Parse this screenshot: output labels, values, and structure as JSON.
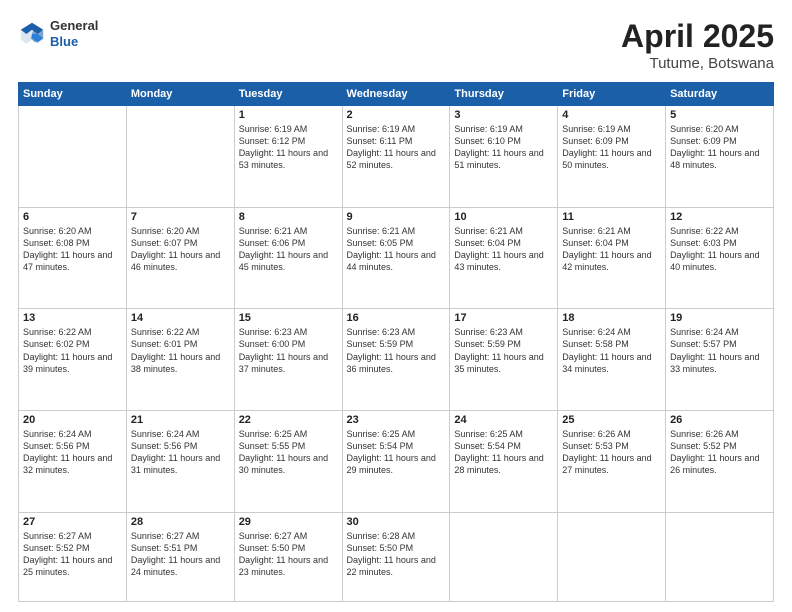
{
  "header": {
    "logo": {
      "general": "General",
      "blue": "Blue"
    },
    "title": "April 2025",
    "location": "Tutume, Botswana"
  },
  "weekdays": [
    "Sunday",
    "Monday",
    "Tuesday",
    "Wednesday",
    "Thursday",
    "Friday",
    "Saturday"
  ],
  "weeks": [
    [
      {
        "day": "",
        "info": ""
      },
      {
        "day": "",
        "info": ""
      },
      {
        "day": "1",
        "info": "Sunrise: 6:19 AM\nSunset: 6:12 PM\nDaylight: 11 hours and 53 minutes."
      },
      {
        "day": "2",
        "info": "Sunrise: 6:19 AM\nSunset: 6:11 PM\nDaylight: 11 hours and 52 minutes."
      },
      {
        "day": "3",
        "info": "Sunrise: 6:19 AM\nSunset: 6:10 PM\nDaylight: 11 hours and 51 minutes."
      },
      {
        "day": "4",
        "info": "Sunrise: 6:19 AM\nSunset: 6:09 PM\nDaylight: 11 hours and 50 minutes."
      },
      {
        "day": "5",
        "info": "Sunrise: 6:20 AM\nSunset: 6:09 PM\nDaylight: 11 hours and 48 minutes."
      }
    ],
    [
      {
        "day": "6",
        "info": "Sunrise: 6:20 AM\nSunset: 6:08 PM\nDaylight: 11 hours and 47 minutes."
      },
      {
        "day": "7",
        "info": "Sunrise: 6:20 AM\nSunset: 6:07 PM\nDaylight: 11 hours and 46 minutes."
      },
      {
        "day": "8",
        "info": "Sunrise: 6:21 AM\nSunset: 6:06 PM\nDaylight: 11 hours and 45 minutes."
      },
      {
        "day": "9",
        "info": "Sunrise: 6:21 AM\nSunset: 6:05 PM\nDaylight: 11 hours and 44 minutes."
      },
      {
        "day": "10",
        "info": "Sunrise: 6:21 AM\nSunset: 6:04 PM\nDaylight: 11 hours and 43 minutes."
      },
      {
        "day": "11",
        "info": "Sunrise: 6:21 AM\nSunset: 6:04 PM\nDaylight: 11 hours and 42 minutes."
      },
      {
        "day": "12",
        "info": "Sunrise: 6:22 AM\nSunset: 6:03 PM\nDaylight: 11 hours and 40 minutes."
      }
    ],
    [
      {
        "day": "13",
        "info": "Sunrise: 6:22 AM\nSunset: 6:02 PM\nDaylight: 11 hours and 39 minutes."
      },
      {
        "day": "14",
        "info": "Sunrise: 6:22 AM\nSunset: 6:01 PM\nDaylight: 11 hours and 38 minutes."
      },
      {
        "day": "15",
        "info": "Sunrise: 6:23 AM\nSunset: 6:00 PM\nDaylight: 11 hours and 37 minutes."
      },
      {
        "day": "16",
        "info": "Sunrise: 6:23 AM\nSunset: 5:59 PM\nDaylight: 11 hours and 36 minutes."
      },
      {
        "day": "17",
        "info": "Sunrise: 6:23 AM\nSunset: 5:59 PM\nDaylight: 11 hours and 35 minutes."
      },
      {
        "day": "18",
        "info": "Sunrise: 6:24 AM\nSunset: 5:58 PM\nDaylight: 11 hours and 34 minutes."
      },
      {
        "day": "19",
        "info": "Sunrise: 6:24 AM\nSunset: 5:57 PM\nDaylight: 11 hours and 33 minutes."
      }
    ],
    [
      {
        "day": "20",
        "info": "Sunrise: 6:24 AM\nSunset: 5:56 PM\nDaylight: 11 hours and 32 minutes."
      },
      {
        "day": "21",
        "info": "Sunrise: 6:24 AM\nSunset: 5:56 PM\nDaylight: 11 hours and 31 minutes."
      },
      {
        "day": "22",
        "info": "Sunrise: 6:25 AM\nSunset: 5:55 PM\nDaylight: 11 hours and 30 minutes."
      },
      {
        "day": "23",
        "info": "Sunrise: 6:25 AM\nSunset: 5:54 PM\nDaylight: 11 hours and 29 minutes."
      },
      {
        "day": "24",
        "info": "Sunrise: 6:25 AM\nSunset: 5:54 PM\nDaylight: 11 hours and 28 minutes."
      },
      {
        "day": "25",
        "info": "Sunrise: 6:26 AM\nSunset: 5:53 PM\nDaylight: 11 hours and 27 minutes."
      },
      {
        "day": "26",
        "info": "Sunrise: 6:26 AM\nSunset: 5:52 PM\nDaylight: 11 hours and 26 minutes."
      }
    ],
    [
      {
        "day": "27",
        "info": "Sunrise: 6:27 AM\nSunset: 5:52 PM\nDaylight: 11 hours and 25 minutes."
      },
      {
        "day": "28",
        "info": "Sunrise: 6:27 AM\nSunset: 5:51 PM\nDaylight: 11 hours and 24 minutes."
      },
      {
        "day": "29",
        "info": "Sunrise: 6:27 AM\nSunset: 5:50 PM\nDaylight: 11 hours and 23 minutes."
      },
      {
        "day": "30",
        "info": "Sunrise: 6:28 AM\nSunset: 5:50 PM\nDaylight: 11 hours and 22 minutes."
      },
      {
        "day": "",
        "info": ""
      },
      {
        "day": "",
        "info": ""
      },
      {
        "day": "",
        "info": ""
      }
    ]
  ]
}
